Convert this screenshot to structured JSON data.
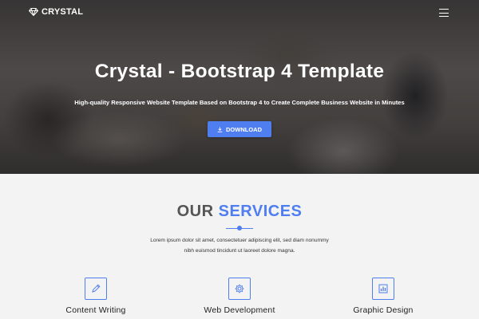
{
  "nav": {
    "brand": "CRYSTAL",
    "brand_icon": "diamond-icon",
    "menu_icon": "hamburger-menu-icon"
  },
  "hero": {
    "title": "Crystal - Bootstrap 4 Template",
    "subtitle": "High-quality Responsive Website Template Based on Bootstrap 4 to Create Complete Business Website in Minutes",
    "button_label": "DOWNLOAD",
    "button_icon": "download-icon"
  },
  "services": {
    "title_part1": "OUR",
    "title_part2": "SERVICES",
    "description_line1": "Lorem ipsum dolor sit amet, consectetuer adipiscing elit, sed diam nonummy",
    "description_line2": "nibh euismod tincidunt ut laoreet dolore magna.",
    "items": [
      {
        "label": "Content Writing",
        "icon": "pencil-icon"
      },
      {
        "label": "Web Development",
        "icon": "gear-icon"
      },
      {
        "label": "Graphic Design",
        "icon": "chart-icon"
      }
    ]
  },
  "colors": {
    "accent": "#4f7ef0",
    "background": "#f3f3f3",
    "text": "#222222"
  }
}
